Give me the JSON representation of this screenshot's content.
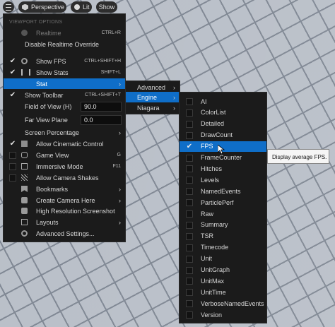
{
  "toolbar": {
    "perspective_label": "Perspective",
    "lit_label": "Lit",
    "show_label": "Show"
  },
  "main_menu": {
    "section_title": "VIEWPORT OPTIONS",
    "realtime": {
      "label": "Realtime",
      "shortcut": "CTRL+R"
    },
    "disable_realtime_override": "Disable Realtime Override",
    "show_fps": {
      "label": "Show FPS",
      "shortcut": "CTRL+SHIFT+H"
    },
    "show_stats": {
      "label": "Show Stats",
      "shortcut": "SHIFT+L"
    },
    "stat": "Stat",
    "show_toolbar": {
      "label": "Show Toolbar",
      "shortcut": "CTRL+SHIFT+T"
    },
    "field_of_view": {
      "label": "Field of View (H)",
      "value": "90.0"
    },
    "far_view_plane": {
      "label": "Far View Plane",
      "value": "0.0"
    },
    "screen_percentage": "Screen Percentage",
    "allow_cinematic_control": "Allow Cinematic Control",
    "game_view": {
      "label": "Game View",
      "shortcut": "G"
    },
    "immersive_mode": {
      "label": "Immersive Mode",
      "shortcut": "F11"
    },
    "allow_camera_shakes": "Allow Camera Shakes",
    "bookmarks": "Bookmarks",
    "create_camera_here": "Create Camera Here",
    "high_res_screenshot": "High Resolution Screenshot...",
    "layouts": "Layouts",
    "advanced_settings": "Advanced Settings..."
  },
  "stat_menu": {
    "items": [
      "Advanced",
      "Engine",
      "Niagara"
    ]
  },
  "engine_menu": {
    "items": [
      "AI",
      "ColorList",
      "Detailed",
      "DrawCount",
      "FPS",
      "FrameCounter",
      "Hitches",
      "Levels",
      "NamedEvents",
      "ParticlePerf",
      "Raw",
      "Summary",
      "TSR",
      "Timecode",
      "Unit",
      "UnitGraph",
      "UnitMax",
      "UnitTime",
      "VerboseNamedEvents",
      "Version"
    ],
    "checked": "FPS"
  },
  "tooltip": "Display average FPS.",
  "colors": {
    "highlight": "#0f6ec8",
    "menu_bg": "#1b1b1b",
    "viewport": "#b9bfc8"
  }
}
